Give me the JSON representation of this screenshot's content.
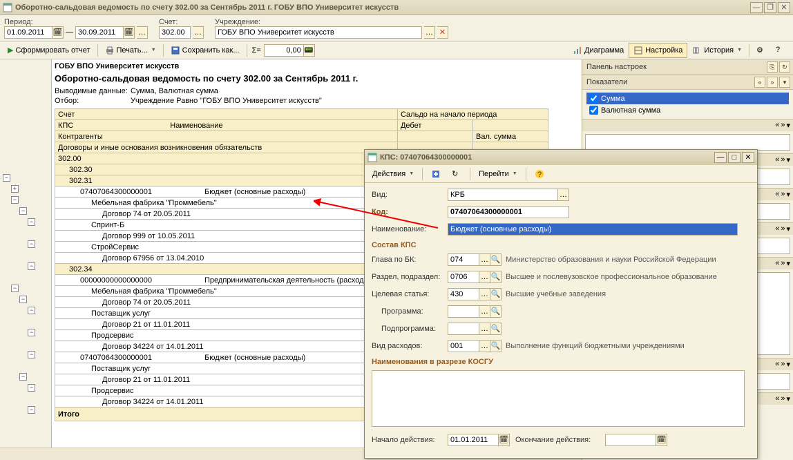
{
  "window": {
    "title": "Оборотно-сальдовая ведомость по счету 302.00 за Сентябрь 2011 г. ГОБУ ВПО Университет искусств"
  },
  "params": {
    "period_label": "Период:",
    "account_label": "Счет:",
    "institution_label": "Учреждение:",
    "date_from": "01.09.2011",
    "date_to": "30.09.2011",
    "account": "302.00",
    "institution": "ГОБУ ВПО Университет искусств"
  },
  "toolbar": {
    "run": "Сформировать отчет",
    "print": "Печать...",
    "save": "Сохранить как...",
    "sigma": "Σ=",
    "sum_value": "0,00",
    "chart": "Диаграмма",
    "settings": "Настройка",
    "history": "История"
  },
  "report": {
    "org": "ГОБУ ВПО Университет искусств",
    "title": "Оборотно-сальдовая ведомость по счету 302.00 за Сентябрь 2011 г.",
    "output_label": "Выводимые данные:",
    "output_value": "Сумма, Валютная сумма",
    "filter_label": "Отбор:",
    "filter_value": "Учреждение Равно \"ГОБУ ВПО Университет искусств\"",
    "headers": {
      "account": "Счет",
      "kps": "КПС",
      "kps_name": "Наименование",
      "counterparty": "Контрагенты",
      "contracts": "Договоры и иные основания возникновения обязательств",
      "open_bal": "Сальдо на начало периода",
      "debit": "Дебет",
      "val_sum": "Вал. сумма"
    },
    "rows": [
      {
        "level": 0,
        "type": "group",
        "c1": "302.00"
      },
      {
        "level": 1,
        "type": "group",
        "c1": "302.30"
      },
      {
        "level": 1,
        "type": "group",
        "c1": "302.31"
      },
      {
        "level": 2,
        "type": "row",
        "c1": "07407064300000001",
        "c2": "Бюджет (основные расходы)"
      },
      {
        "level": 3,
        "type": "row",
        "c1": "Мебельная фабрика \"Проммебель\""
      },
      {
        "level": 4,
        "type": "row",
        "c1": "Договор 74 от 20.05.2011"
      },
      {
        "level": 3,
        "type": "row",
        "c1": "Спринт-Б"
      },
      {
        "level": 4,
        "type": "row",
        "c1": "Договор 999 от 10.05.2011"
      },
      {
        "level": 3,
        "type": "row",
        "c1": "СтройСервис"
      },
      {
        "level": 4,
        "type": "row",
        "c1": "Договор 67956 от 13.04.2010"
      },
      {
        "level": 1,
        "type": "group",
        "c1": "302.34"
      },
      {
        "level": 2,
        "type": "row",
        "c1": "00000000000000000",
        "c2": "Предпринимательская деятельность (расход"
      },
      {
        "level": 3,
        "type": "row",
        "c1": "Мебельная фабрика \"Проммебель\""
      },
      {
        "level": 4,
        "type": "row",
        "c1": "Договор 74 от 20.05.2011"
      },
      {
        "level": 3,
        "type": "row",
        "c1": "Поставщик услуг"
      },
      {
        "level": 4,
        "type": "row",
        "c1": "Договор 21 от 11.01.2011"
      },
      {
        "level": 3,
        "type": "row",
        "c1": "Продсервис"
      },
      {
        "level": 4,
        "type": "row",
        "c1": "Договор 34224 от 14.01.2011"
      },
      {
        "level": 2,
        "type": "row",
        "c1": "07407064300000001",
        "c2": "Бюджет (основные расходы)"
      },
      {
        "level": 3,
        "type": "row",
        "c1": "Поставщик услуг"
      },
      {
        "level": 4,
        "type": "row",
        "c1": "Договор 21 от 11.01.2011"
      },
      {
        "level": 3,
        "type": "row",
        "c1": "Продсервис"
      },
      {
        "level": 4,
        "type": "row",
        "c1": "Договор 34224 от 14.01.2011"
      }
    ],
    "totals": "Итого"
  },
  "settings_panel": {
    "title": "Панель настроек",
    "section": "Показатели",
    "chk1": "Сумма",
    "chk2": "Валютная сумма"
  },
  "dialog": {
    "title": "КПС: 07407064300000001",
    "actions": "Действия",
    "goto": "Перейти",
    "kind_label": "Вид:",
    "kind_value": "КРБ",
    "code_label": "Код:",
    "code_value": "07407064300000001",
    "name_label": "Наименование:",
    "name_value": "Бюджет (основные расходы)",
    "composition": "Состав КПС",
    "glava_label": "Глава по БК:",
    "glava_value": "074",
    "glava_desc": "Министерство образования и науки Российской Федерации",
    "razdel_label": "Раздел, подраздел:",
    "razdel_value": "0706",
    "razdel_desc": "Высшее и послевузовское профессиональное образование",
    "target_label": "Целевая статья:",
    "target_value": "430",
    "target_desc": "Высшие учебные заведения",
    "program_label": "Программа:",
    "subprogram_label": "Подпрограмма:",
    "expense_label": "Вид расходов:",
    "expense_value": "001",
    "expense_desc": "Выполнение функций бюджетными учреждениями",
    "kosgu_head": "Наименования в разрезе КОСГУ",
    "start_label": "Начало действия:",
    "start_value": "01.01.2011",
    "end_label": "Окончание действия:"
  }
}
